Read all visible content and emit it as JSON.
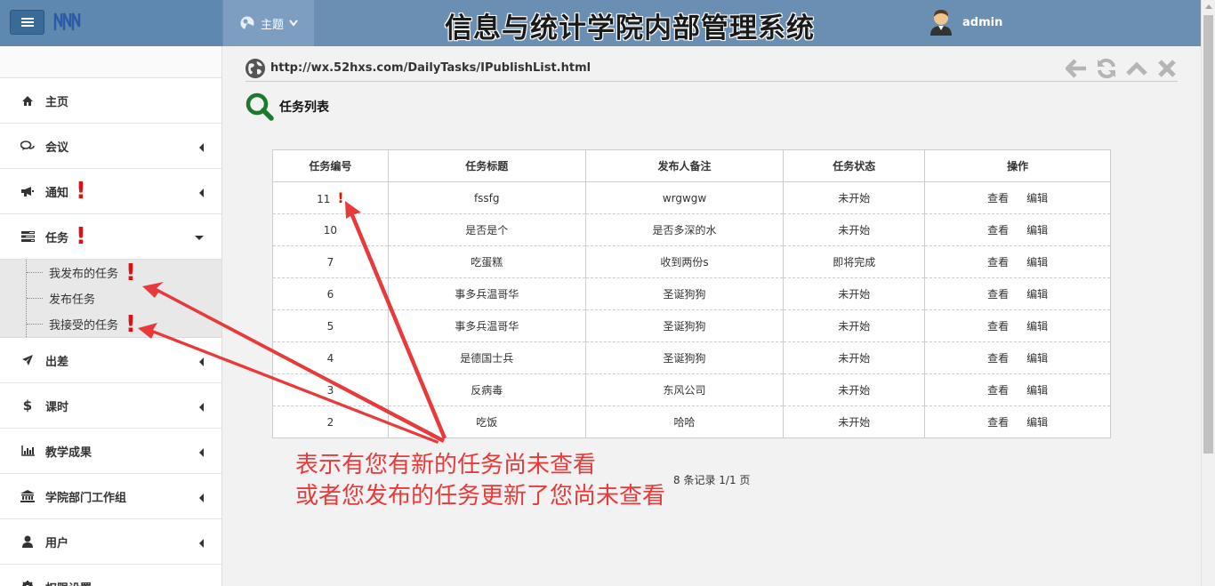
{
  "header": {
    "system_title": "信息与统计学院内部管理系统",
    "theme_label": "主题",
    "username": "admin"
  },
  "sidebar": {
    "items": [
      {
        "label": "主页",
        "icon": "home-icon"
      },
      {
        "label": "会议",
        "icon": "comments-icon"
      },
      {
        "label": "通知",
        "icon": "bullhorn-icon",
        "alert": "!"
      },
      {
        "label": "任务",
        "icon": "tasks-icon",
        "alert": "!"
      },
      {
        "label": "出差",
        "icon": "plane-icon"
      },
      {
        "label": "课时",
        "icon": "dollar-icon"
      },
      {
        "label": "教学成果",
        "icon": "bar-chart-icon"
      },
      {
        "label": "学院部门工作组",
        "icon": "institution-icon"
      },
      {
        "label": "用户",
        "icon": "user-icon"
      },
      {
        "label": "权限设置",
        "icon": "gear-icon"
      }
    ],
    "task_sub_items": [
      {
        "label": "我发布的任务",
        "alert": "!"
      },
      {
        "label": "发布任务"
      },
      {
        "label": "我接受的任务",
        "alert": "!"
      }
    ]
  },
  "address": {
    "url": "http://wx.52hxs.com/DailyTasks/IPublishList.html"
  },
  "page": {
    "title": "任务列表"
  },
  "table": {
    "headers": [
      "任务编号",
      "任务标题",
      "发布人备注",
      "任务状态",
      "操作"
    ],
    "view_label": "查看",
    "edit_label": "编辑",
    "rows": [
      {
        "id": "11",
        "title": "fssfg",
        "note": "wrgwgw",
        "status": "未开始",
        "alert": "!"
      },
      {
        "id": "10",
        "title": "是否是个",
        "note": "是否多深的水",
        "status": "未开始"
      },
      {
        "id": "7",
        "title": "吃蛋糕",
        "note": "收到两份s",
        "status": "即将完成"
      },
      {
        "id": "6",
        "title": "事多兵温哥华",
        "note": "圣诞狗狗",
        "status": "未开始"
      },
      {
        "id": "5",
        "title": "事多兵温哥华",
        "note": "圣诞狗狗",
        "status": "未开始"
      },
      {
        "id": "4",
        "title": "是德国士兵",
        "note": "圣诞狗狗",
        "status": "未开始"
      },
      {
        "id": "3",
        "title": "反病毒",
        "note": "东风公司",
        "status": "未开始"
      },
      {
        "id": "2",
        "title": "吃饭",
        "note": "哈哈",
        "status": "未开始"
      }
    ],
    "pagination": "8 条记录 1/1 页"
  },
  "annotation": {
    "line1": "表示有您有新的任务尚未查看",
    "line2": "或者您发布的任务更新了您尚未查看",
    "color": "#e83a3a"
  },
  "colors": {
    "header_bg": "#6b8fb3",
    "alert_red": "#e01010",
    "search_green": "#1a7a2e"
  }
}
